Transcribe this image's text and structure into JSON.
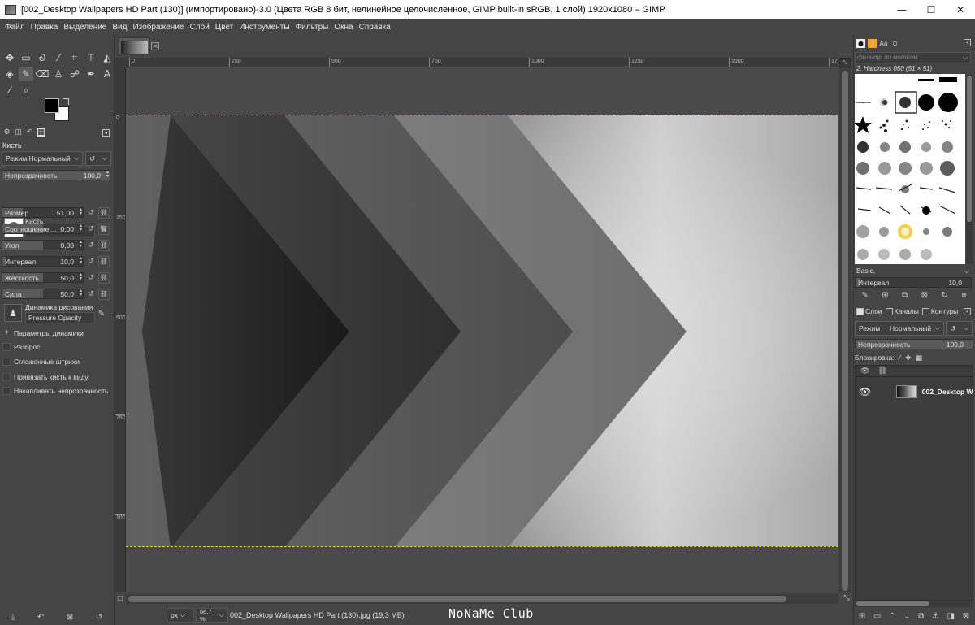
{
  "window": {
    "title": "[002_Desktop Wallpapers  HD Part (130)] (импортировано)-3.0 (Цвета RGB 8 бит, нелинейное целочисленное, GIMP built-in sRGB, 1 слой) 1920x1080 – GIMP",
    "minimize": "—",
    "maximize": "☐",
    "close": "✕"
  },
  "menu": [
    "Файл",
    "Правка",
    "Выделение",
    "Вид",
    "Изображение",
    "Слой",
    "Цвет",
    "Инструменты",
    "Фильтры",
    "Окна",
    "Справка"
  ],
  "tool_options": {
    "title": "Кисть",
    "mode_label": "Режим",
    "mode_value": "Нормальный",
    "opacity_label": "Непрозрачность",
    "opacity_value": "100,0",
    "brush_label": "Кисть",
    "brush_name": "2. Hardness 050",
    "sliders": [
      {
        "label": "Размер",
        "value": "51,00",
        "fill": 0.25
      },
      {
        "label": "Соотношение ...",
        "value": "0,00",
        "fill": 0.5
      },
      {
        "label": "Угол",
        "value": "0,00",
        "fill": 0.5
      },
      {
        "label": "Интервал",
        "value": "10,0",
        "fill": 0.05
      },
      {
        "label": "Жёсткость",
        "value": "50,0",
        "fill": 0.5
      },
      {
        "label": "Сила",
        "value": "50,0",
        "fill": 0.5
      }
    ],
    "dynamics_label": "Динамика рисования",
    "dynamics_value": "Pressure Opacity",
    "checks": [
      "Параметры динамики",
      "Разброс",
      "Сглаженные штрихи",
      "Привязать кисть к виду",
      "Накапливать непрозрачность"
    ]
  },
  "canvas": {
    "ruler_h": [
      "0",
      "250",
      "500",
      "750",
      "1000",
      "1250",
      "1500",
      "1750"
    ],
    "ruler_v": [
      "0",
      "250",
      "500",
      "750",
      "1000"
    ]
  },
  "status": {
    "unit": "px",
    "zoom": "66,7 %",
    "file_info": "002_Desktop Wallpapers  HD Part (130).jpg (19,3 МБ)",
    "watermark": "NoNaMe Club"
  },
  "brushes_panel": {
    "filter_placeholder": "фильтр по меткам",
    "selected_brush": "2. Hardness 050 (51 × 51)",
    "tag": "Basic,",
    "interval_label": "Интервал",
    "interval_value": "10,0"
  },
  "layers_panel": {
    "tabs": [
      "Слои",
      "Каналы",
      "Контуры"
    ],
    "mode_label": "Режим",
    "mode_value": "Нормальный",
    "opacity_label": "Непрозрачность",
    "opacity_value": "100,0",
    "lock_label": "Блокировка:",
    "layer_name": "002_Desktop W"
  },
  "colors": {
    "background": "#454545",
    "selection_border": "#d6d63a"
  }
}
